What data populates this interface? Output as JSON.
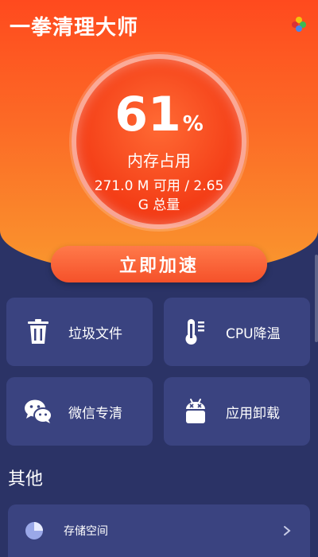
{
  "app": {
    "title": "一拳清理大师"
  },
  "gauge": {
    "percent_value": "61",
    "percent_sign": "%",
    "label": "内存占用",
    "detail": "271.0 M 可用 / 2.65 G 总量"
  },
  "boost_button": {
    "label": "立即加速"
  },
  "cards": [
    {
      "label": "垃圾文件",
      "icon": "trash-icon"
    },
    {
      "label": "CPU降温",
      "icon": "thermometer-icon"
    },
    {
      "label": "微信专清",
      "icon": "wechat-icon"
    },
    {
      "label": "应用卸载",
      "icon": "android-icon"
    }
  ],
  "others": {
    "title": "其他",
    "items": [
      {
        "label": "存储空间",
        "icon": "pie-chart-icon"
      }
    ]
  },
  "colors": {
    "hero_top": "#ff4a1e",
    "hero_bottom": "#f9972e",
    "background": "#2b3366",
    "card": "#3a4380",
    "accent": "#f5512a"
  }
}
